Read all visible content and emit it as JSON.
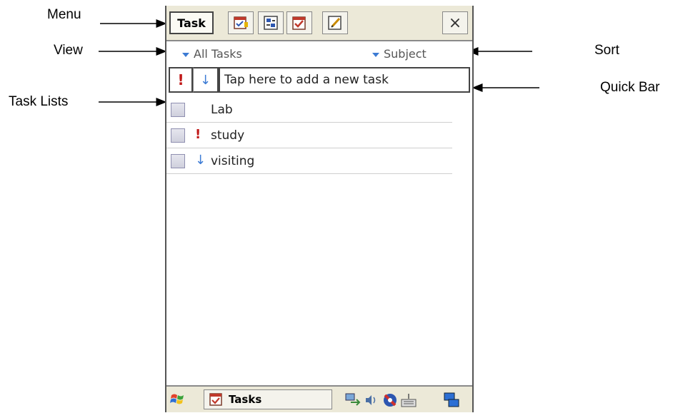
{
  "annotations": {
    "menu": "Menu",
    "view": "View",
    "sort": "Sort",
    "task_lists": "Task Lists",
    "quick_bar": "Quick Bar"
  },
  "toolbar": {
    "menu_label": "Task",
    "icons": [
      "new-task-icon",
      "sync-icon",
      "complete-task-icon",
      "edit-note-icon"
    ],
    "close_label": "×"
  },
  "viewbar": {
    "view_selected": "All Tasks",
    "sort_selected": "Subject"
  },
  "quickbar": {
    "priority_high": "!",
    "priority_low": "↓",
    "input_placeholder": "Tap here to add a new task"
  },
  "tasks": [
    {
      "name": "Lab",
      "priority": ""
    },
    {
      "name": "study",
      "priority": "!"
    },
    {
      "name": "visiting",
      "priority": "↓"
    }
  ],
  "taskbar": {
    "active_app": "Tasks"
  },
  "colors": {
    "priority_high": "#c01818",
    "priority_low": "#3c7bd4",
    "chrome": "#ece9d8"
  }
}
